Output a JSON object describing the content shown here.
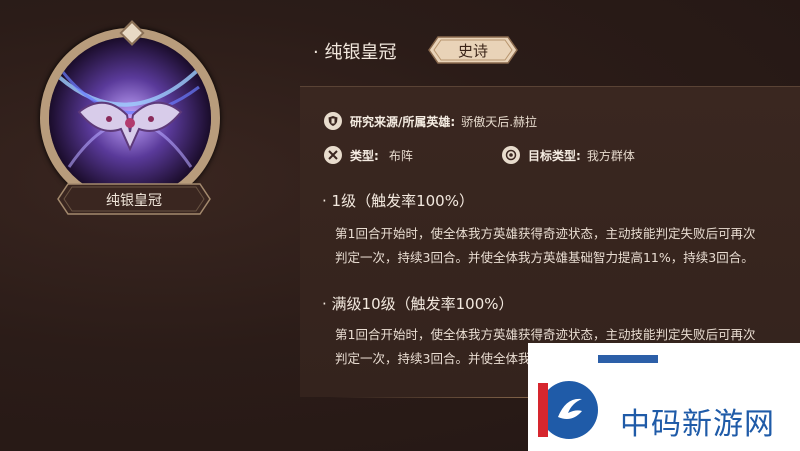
{
  "item": {
    "name": "纯银皇冠",
    "rarity": "史诗",
    "plate_name": "纯银皇冠"
  },
  "info": {
    "source_label": "研究来源/所属英雄:",
    "source_value": "骄傲天后.赫拉",
    "type_label": "类型:",
    "type_value": "布阵",
    "target_label": "目标类型:",
    "target_value": "我方群体"
  },
  "levels": [
    {
      "title": "· 1级（触发率100%）",
      "line1": "第1回合开始时，使全体我方英雄获得奇迹状态，主动技能判定失败后可再次",
      "line2": "判定一次，持续3回合。并使全体我方英雄基础智力提高11%，持续3回合。"
    },
    {
      "title": "· 满级10级（触发率100%）",
      "line1": "第1回合开始时，使全体我方英雄获得奇迹状态，主动技能判定失败后可再次",
      "line2": "判定一次，持续3回合。并使全体我方"
    }
  ],
  "watermark": {
    "text": "中码新游网"
  },
  "colors": {
    "background": "#2a1a16",
    "panel": "#3a2720",
    "frame": "#b89c7c",
    "badge": "#e9d3b8",
    "watermark_blue": "#1f5ba8"
  }
}
